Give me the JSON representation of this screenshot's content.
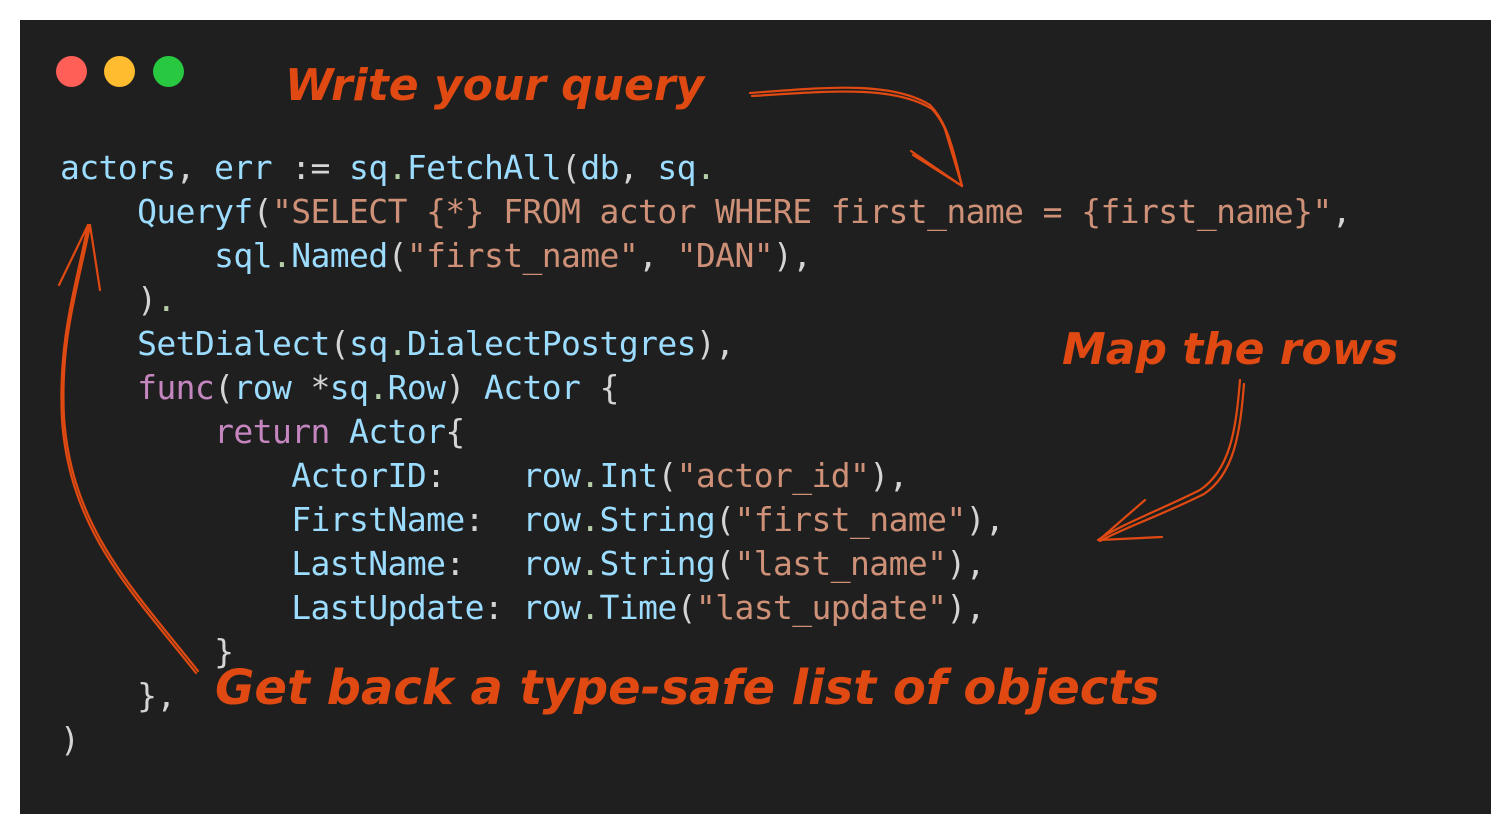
{
  "window": {
    "controls": [
      {
        "name": "close",
        "color": "#ff5f57"
      },
      {
        "name": "minimize",
        "color": "#febc2e"
      },
      {
        "name": "maximize",
        "color": "#28c840"
      }
    ],
    "background": "#1f1f1f"
  },
  "code": {
    "language": "go",
    "lines": [
      [
        {
          "t": "actors",
          "c": "id"
        },
        {
          "t": ", ",
          "c": "punc"
        },
        {
          "t": "err",
          "c": "id"
        },
        {
          "t": " := ",
          "c": "punc"
        },
        {
          "t": "sq",
          "c": "id"
        },
        {
          "t": ".",
          "c": "dot"
        },
        {
          "t": "FetchAll",
          "c": "fn"
        },
        {
          "t": "(",
          "c": "punc"
        },
        {
          "t": "db",
          "c": "id"
        },
        {
          "t": ", ",
          "c": "punc"
        },
        {
          "t": "sq",
          "c": "id"
        },
        {
          "t": ".",
          "c": "dot"
        }
      ],
      [
        {
          "t": "    ",
          "c": "punc"
        },
        {
          "t": "Queryf",
          "c": "fn"
        },
        {
          "t": "(",
          "c": "punc"
        },
        {
          "t": "\"SELECT {*} FROM actor WHERE first_name = {first_name}\"",
          "c": "str"
        },
        {
          "t": ",",
          "c": "punc"
        }
      ],
      [
        {
          "t": "        ",
          "c": "punc"
        },
        {
          "t": "sql",
          "c": "id"
        },
        {
          "t": ".",
          "c": "dot"
        },
        {
          "t": "Named",
          "c": "fn"
        },
        {
          "t": "(",
          "c": "punc"
        },
        {
          "t": "\"first_name\"",
          "c": "str"
        },
        {
          "t": ", ",
          "c": "punc"
        },
        {
          "t": "\"DAN\"",
          "c": "str"
        },
        {
          "t": "),",
          "c": "punc"
        }
      ],
      [
        {
          "t": "    ",
          "c": "punc"
        },
        {
          "t": ")",
          "c": "punc"
        },
        {
          "t": ".",
          "c": "dot"
        }
      ],
      [
        {
          "t": "    ",
          "c": "punc"
        },
        {
          "t": "SetDialect",
          "c": "fn"
        },
        {
          "t": "(",
          "c": "punc"
        },
        {
          "t": "sq",
          "c": "id"
        },
        {
          "t": ".",
          "c": "dot"
        },
        {
          "t": "DialectPostgres",
          "c": "id"
        },
        {
          "t": "),",
          "c": "punc"
        }
      ],
      [
        {
          "t": "    ",
          "c": "punc"
        },
        {
          "t": "func",
          "c": "kw"
        },
        {
          "t": "(",
          "c": "punc"
        },
        {
          "t": "row",
          "c": "id"
        },
        {
          "t": " *",
          "c": "punc"
        },
        {
          "t": "sq",
          "c": "id"
        },
        {
          "t": ".",
          "c": "dot"
        },
        {
          "t": "Row",
          "c": "id"
        },
        {
          "t": ") ",
          "c": "punc"
        },
        {
          "t": "Actor",
          "c": "id"
        },
        {
          "t": " {",
          "c": "punc"
        }
      ],
      [
        {
          "t": "        ",
          "c": "punc"
        },
        {
          "t": "return",
          "c": "kw"
        },
        {
          "t": " ",
          "c": "punc"
        },
        {
          "t": "Actor",
          "c": "id"
        },
        {
          "t": "{",
          "c": "punc"
        }
      ],
      [
        {
          "t": "            ",
          "c": "punc"
        },
        {
          "t": "ActorID",
          "c": "id"
        },
        {
          "t": ":    ",
          "c": "punc"
        },
        {
          "t": "row",
          "c": "id"
        },
        {
          "t": ".",
          "c": "dot"
        },
        {
          "t": "Int",
          "c": "fn"
        },
        {
          "t": "(",
          "c": "punc"
        },
        {
          "t": "\"actor_id\"",
          "c": "str"
        },
        {
          "t": "),",
          "c": "punc"
        }
      ],
      [
        {
          "t": "            ",
          "c": "punc"
        },
        {
          "t": "FirstName",
          "c": "id"
        },
        {
          "t": ":  ",
          "c": "punc"
        },
        {
          "t": "row",
          "c": "id"
        },
        {
          "t": ".",
          "c": "dot"
        },
        {
          "t": "String",
          "c": "fn"
        },
        {
          "t": "(",
          "c": "punc"
        },
        {
          "t": "\"first_name\"",
          "c": "str"
        },
        {
          "t": "),",
          "c": "punc"
        }
      ],
      [
        {
          "t": "            ",
          "c": "punc"
        },
        {
          "t": "LastName",
          "c": "id"
        },
        {
          "t": ":   ",
          "c": "punc"
        },
        {
          "t": "row",
          "c": "id"
        },
        {
          "t": ".",
          "c": "dot"
        },
        {
          "t": "String",
          "c": "fn"
        },
        {
          "t": "(",
          "c": "punc"
        },
        {
          "t": "\"last_name\"",
          "c": "str"
        },
        {
          "t": "),",
          "c": "punc"
        }
      ],
      [
        {
          "t": "            ",
          "c": "punc"
        },
        {
          "t": "LastUpdate",
          "c": "id"
        },
        {
          "t": ": ",
          "c": "punc"
        },
        {
          "t": "row",
          "c": "id"
        },
        {
          "t": ".",
          "c": "dot"
        },
        {
          "t": "Time",
          "c": "fn"
        },
        {
          "t": "(",
          "c": "punc"
        },
        {
          "t": "\"last_update\"",
          "c": "str"
        },
        {
          "t": "),",
          "c": "punc"
        }
      ],
      [
        {
          "t": "        }",
          "c": "punc"
        }
      ],
      [
        {
          "t": "    },",
          "c": "punc"
        }
      ],
      [
        {
          "t": ")",
          "c": "punc"
        }
      ]
    ]
  },
  "annotations": {
    "write_query": "Write your query",
    "map_rows": "Map the rows",
    "get_back": "Get back a type-safe list of objects",
    "color": "#e04a12"
  }
}
